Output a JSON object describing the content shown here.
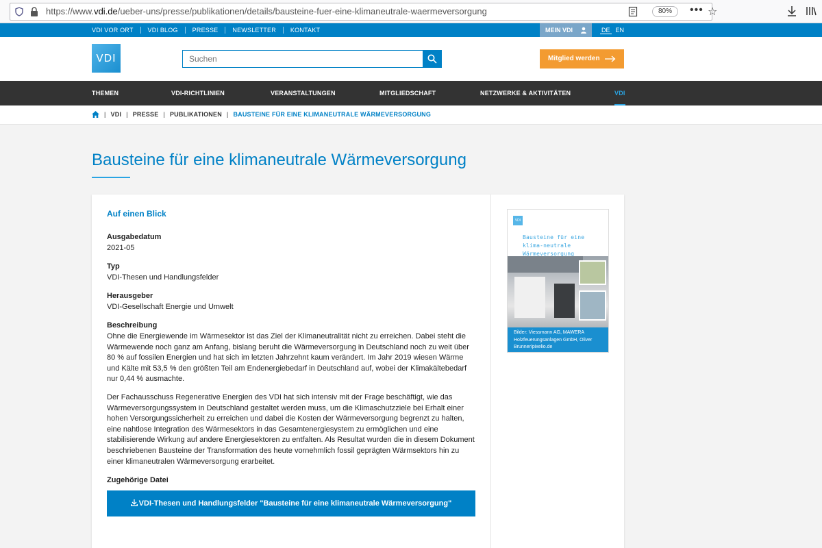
{
  "browser": {
    "url_prefix": "https://www.",
    "url_domain": "vdi.de",
    "url_path": "/ueber-uns/presse/publikationen/details/bausteine-fuer-eine-klimaneutrale-waermeversorgung",
    "zoom": "80%"
  },
  "topbar": {
    "links": [
      "VDI VOR ORT",
      "VDI BLOG",
      "PRESSE",
      "NEWSLETTER",
      "KONTAKT"
    ],
    "mein_vdi": "MEIN VDI",
    "lang_de": "DE",
    "lang_en": "EN"
  },
  "header": {
    "logo": "VDI",
    "search_placeholder": "Suchen",
    "member_button": "Mitglied werden"
  },
  "nav": {
    "items": [
      "THEMEN",
      "VDI-RICHTLINIEN",
      "VERANSTALTUNGEN",
      "MITGLIEDSCHAFT",
      "NETZWERKE & AKTIVITÄTEN",
      "VDI"
    ]
  },
  "breadcrumb": {
    "items": [
      "VDI",
      "PRESSE",
      "PUBLIKATIONEN"
    ],
    "current": "BAUSTEINE FÜR EINE KLIMANEUTRALE WÄRMEVERSORGUNG"
  },
  "page": {
    "title": "Bausteine für eine klimaneutrale Wärmeversorgung"
  },
  "details": {
    "section_title": "Auf einen Blick",
    "date_label": "Ausgabedatum",
    "date_value": "2021-05",
    "type_label": "Typ",
    "type_value": "VDI-Thesen und Handlungsfelder",
    "publisher_label": "Herausgeber",
    "publisher_value": "VDI-Gesellschaft Energie und Umwelt",
    "description_label": "Beschreibung",
    "description_p1": "Ohne die Energiewende im Wärmesektor ist das Ziel der Klimaneutralität nicht zu erreichen. Dabei steht die Wärmewende noch ganz am Anfang, bislang beruht die Wärmeversorgung in Deutschland noch zu weit über 80 % auf fossilen Energien und hat sich im letzten Jahrzehnt kaum verändert. Im Jahr 2019 wiesen Wärme und Kälte mit 53,5 % den größten Teil am Endenergiebedarf in Deutschland auf, wobei der Klimakältebedarf nur 0,44 % ausmachte.",
    "description_p2": "Der Fachausschuss Regenerative Energien des VDI hat sich intensiv mit der Frage beschäftigt, wie das Wärmeversorgungssystem in Deutschland gestaltet werden muss, um die Klimaschutzziele bei Erhalt einer hohen Versorgungssicherheit zu erreichen und dabei die Kosten der Wärmeversorgung begrenzt zu halten, eine nahtlose Integration des Wärmesektors in das Gesamtenergiesystem zu ermöglichen und eine stabilisierende Wirkung auf andere Energiesektoren zu entfalten. Als Resultat wurden die in diesem Dokument beschriebenen Bausteine der Transformation des heute vornehmlich fossil geprägten Wärmsektors hin zu einer klimaneutralen Wärmeversorgung erarbeitet.",
    "file_label": "Zugehörige Datei",
    "download_label": "VDI-Thesen und Handlungsfelder \"Bausteine für eine klimaneutrale Wärmeversorgung\""
  },
  "cover": {
    "logo": "VDI",
    "title": "Bausteine für eine klima-neutrale Wärmeversorgung",
    "credit": "Bilder: Viessmann AG, MAWERA Holzfeuerungsanlagen GmbH, Oliver Brunner/pixelio.de"
  },
  "colors": {
    "brand_blue": "#0081c6",
    "accent_orange": "#f39b31",
    "nav_dark": "#333333"
  }
}
